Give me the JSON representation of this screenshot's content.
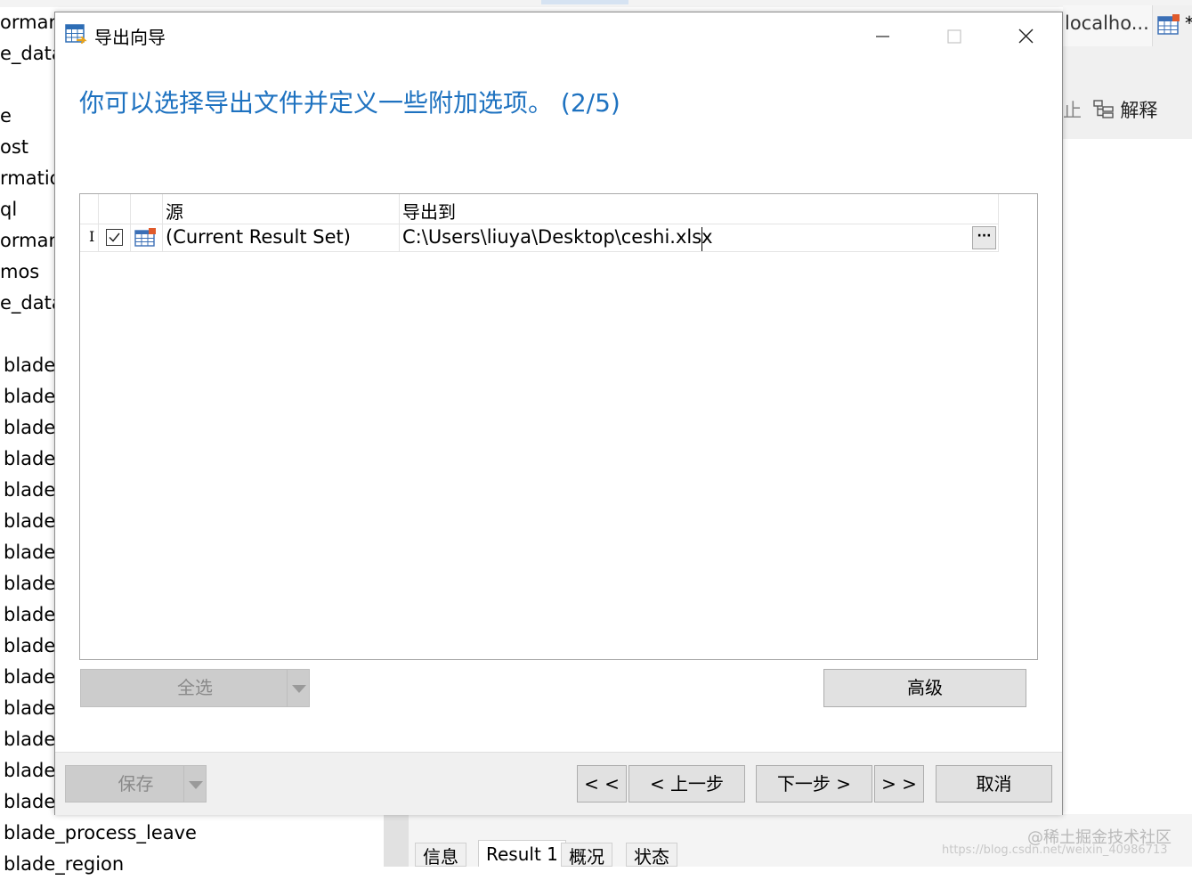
{
  "background_app": {
    "left_list": [
      "orman",
      "e_data",
      "e",
      "ost",
      "rmatio",
      "ql",
      "orman",
      "mos",
      "e_data",
      "blade_",
      "blade_",
      "blade_",
      "blade_",
      "blade_",
      "blade_",
      "blade_",
      "blade_",
      "blade_",
      "blade_",
      "blade_",
      "blade_",
      "blade_",
      "blade_",
      "blade_",
      "blade_process_leave",
      "blade_region"
    ],
    "right_tab_label": "localho...",
    "right_tab_marker": "*",
    "toolbar_stop_fragment": "止",
    "toolbar_explain_label": "解释",
    "bottom_tabs": [
      "信息",
      "Result 1",
      "概况",
      "状态"
    ],
    "active_bottom_tab": "Result 1",
    "watermark_main": "@稀土掘金技术社区",
    "watermark_url": "https://blog.csdn.net/weixin_40986713"
  },
  "dialog": {
    "title": "导出向导",
    "heading": "你可以选择导出文件并定义一些附加选项。 (2/5)",
    "grid": {
      "columns": [
        "源",
        "导出到"
      ],
      "rows": [
        {
          "checked": true,
          "source": "(Current Result Set)",
          "target": "C:\\Users\\liuya\\Desktop\\ceshi.xlsx",
          "browse_label": "···"
        }
      ]
    },
    "select_all_label": "全选",
    "advanced_label": "高级",
    "footer": {
      "save_label": "保存",
      "first_label": "< <",
      "prev_label": "< 上一步",
      "next_label": "下一步 >",
      "last_label": "> >",
      "cancel_label": "取消"
    }
  },
  "colors": {
    "heading": "#1e72c0",
    "disabled_button": "#cccccc",
    "button": "#e1e1e1"
  }
}
